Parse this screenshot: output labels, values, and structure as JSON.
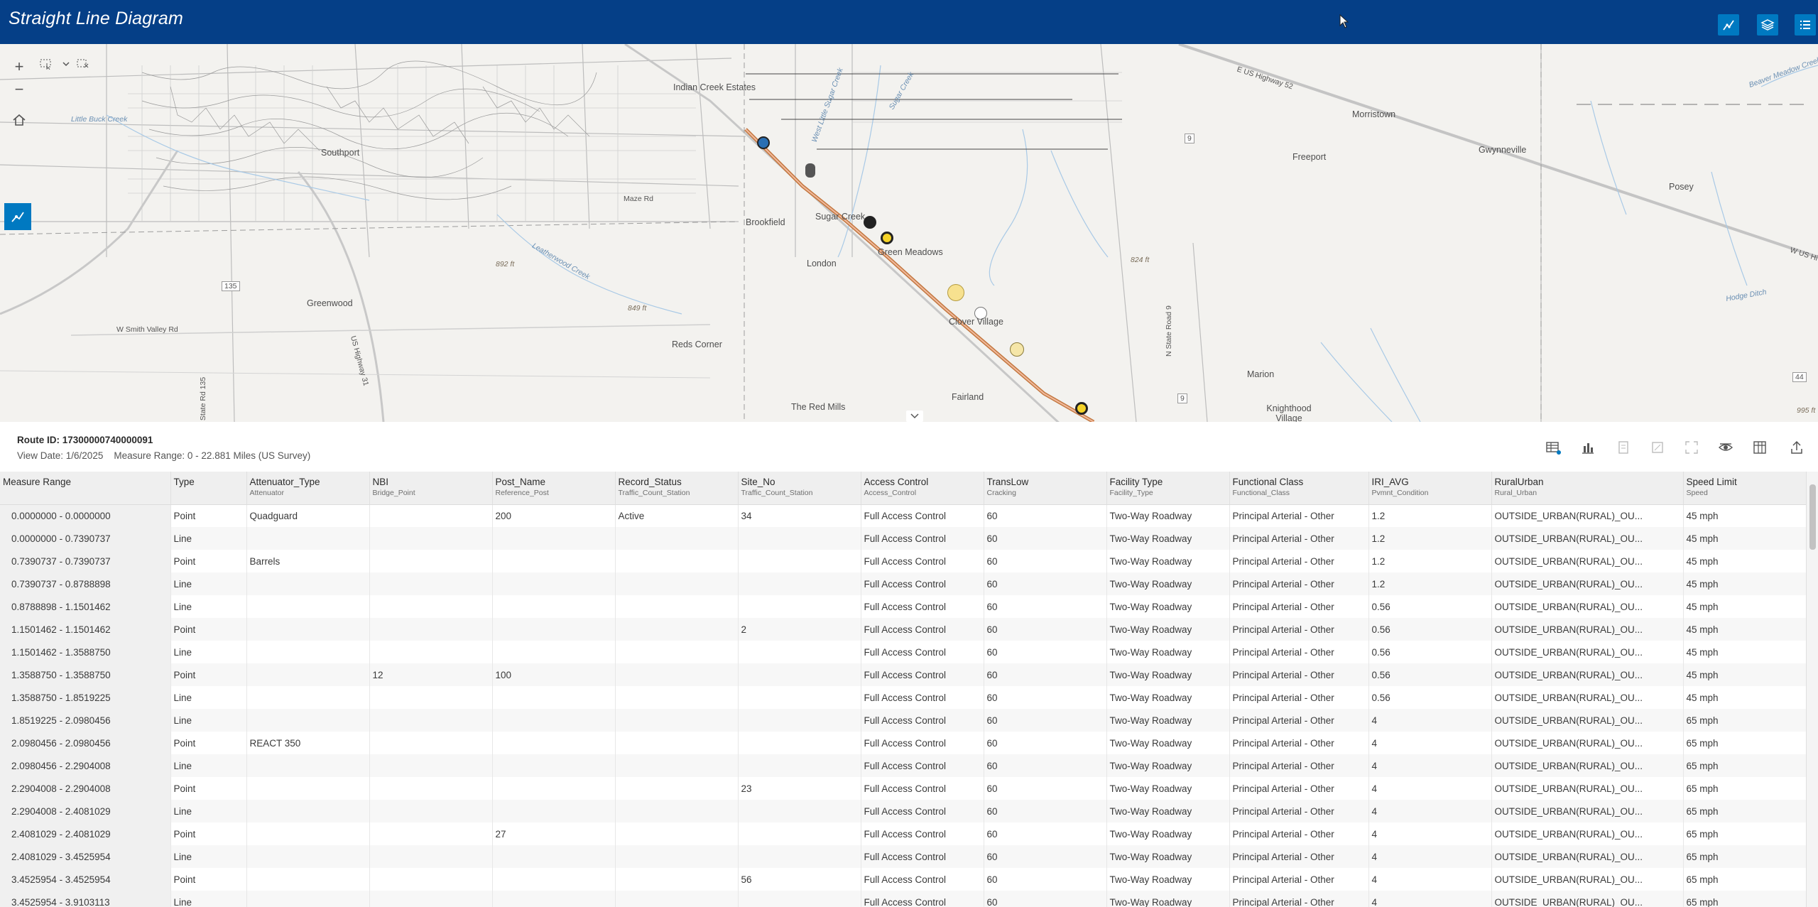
{
  "app": {
    "title": "Straight Line Diagram"
  },
  "colors": {
    "header": "#053f87",
    "accent": "#0079c1"
  },
  "header_buttons": [
    {
      "icon": "sld-chart-icon"
    },
    {
      "icon": "layers-icon"
    },
    {
      "icon": "list-icon"
    }
  ],
  "map": {
    "zoom_in": "+",
    "zoom_out": "−",
    "labels": {
      "indian_creek": "Indian Creek Estates",
      "southport": "Southport",
      "brookfield": "Brookfield",
      "sugar_creek": "Sugar Creek",
      "shelbyville_meadows": "Green Meadows",
      "london": "London",
      "greenwood": "Greenwood",
      "smith_valley": "W Smith Valley Rd",
      "reds_corner": "Reds Corner",
      "clover": "Clover Village",
      "fairland": "Fairland",
      "red_mills": "The Red Mills",
      "marion": "Marion",
      "knighthood": "Knighthood Village",
      "morristown": "Morristown",
      "gwynneville": "Gwynneville",
      "freeport": "Freeport",
      "posey": "Posey",
      "us52": "E US Highway 52",
      "us52b": "W US Hi",
      "maze": "Maze Rd",
      "elev1": "892 ft",
      "elev2": "849 ft",
      "elev3": "824 ft",
      "elev4": "995 ft",
      "r135": "135",
      "r9a": "9",
      "r9b": "9",
      "r44": "44",
      "state_road_9": "N State Road 9",
      "little_buck": "Little Buck Creek",
      "leatherwood": "Leatherwood Creek",
      "sugar_creek_w": "West Little Sugar Creek",
      "sugar_creek_e": "Sugar Creek",
      "hodge": "Hodge Ditch",
      "beaver": "Beaver Meadow Creek",
      "us31": "US Highway 31",
      "s_state_rd": "S State Rd 135"
    }
  },
  "info": {
    "route_id": "Route ID: 17300000740000091",
    "view_date": "View Date: 1/6/2025",
    "measure_range": "Measure Range: 0 - 22.881 Miles (US Survey)"
  },
  "table": {
    "columns": [
      {
        "title": "Measure Range",
        "sub": ""
      },
      {
        "title": "Type",
        "sub": ""
      },
      {
        "title": "Attenuator_Type",
        "sub": "Attenuator"
      },
      {
        "title": "NBI",
        "sub": "Bridge_Point"
      },
      {
        "title": "Post_Name",
        "sub": "Reference_Post"
      },
      {
        "title": "Record_Status",
        "sub": "Traffic_Count_Station"
      },
      {
        "title": "Site_No",
        "sub": "Traffic_Count_Station"
      },
      {
        "title": "Access Control",
        "sub": "Access_Control"
      },
      {
        "title": "TransLow",
        "sub": "Cracking"
      },
      {
        "title": "Facility Type",
        "sub": "Facility_Type"
      },
      {
        "title": "Functional Class",
        "sub": "Functional_Class"
      },
      {
        "title": "IRI_AVG",
        "sub": "Pvmnt_Condition"
      },
      {
        "title": "RuralUrban",
        "sub": "Rural_Urban"
      },
      {
        "title": "Speed Limit",
        "sub": "Speed"
      }
    ],
    "rows": [
      [
        "0.0000000  -  0.0000000",
        "Point",
        "Quadguard",
        "",
        "200",
        "Active",
        "34",
        "Full Access Control",
        "60",
        "Two-Way Roadway",
        "Principal Arterial - Other",
        "1.2",
        "OUTSIDE_URBAN(RURAL)_OU...",
        "45 mph"
      ],
      [
        "0.0000000  -  0.7390737",
        "Line",
        "",
        "",
        "",
        "",
        "",
        "Full Access Control",
        "60",
        "Two-Way Roadway",
        "Principal Arterial - Other",
        "1.2",
        "OUTSIDE_URBAN(RURAL)_OU...",
        "45 mph"
      ],
      [
        "0.7390737  -  0.7390737",
        "Point",
        "Barrels",
        "",
        "",
        "",
        "",
        "Full Access Control",
        "60",
        "Two-Way Roadway",
        "Principal Arterial - Other",
        "1.2",
        "OUTSIDE_URBAN(RURAL)_OU...",
        "45 mph"
      ],
      [
        "0.7390737  -  0.8788898",
        "Line",
        "",
        "",
        "",
        "",
        "",
        "Full Access Control",
        "60",
        "Two-Way Roadway",
        "Principal Arterial - Other",
        "1.2",
        "OUTSIDE_URBAN(RURAL)_OU...",
        "45 mph"
      ],
      [
        "0.8788898  -  1.1501462",
        "Line",
        "",
        "",
        "",
        "",
        "",
        "Full Access Control",
        "60",
        "Two-Way Roadway",
        "Principal Arterial - Other",
        "0.56",
        "OUTSIDE_URBAN(RURAL)_OU...",
        "45 mph"
      ],
      [
        "1.1501462  -  1.1501462",
        "Point",
        "",
        "",
        "",
        "",
        "2",
        "Full Access Control",
        "60",
        "Two-Way Roadway",
        "Principal Arterial - Other",
        "0.56",
        "OUTSIDE_URBAN(RURAL)_OU...",
        "45 mph"
      ],
      [
        "1.1501462  -  1.3588750",
        "Line",
        "",
        "",
        "",
        "",
        "",
        "Full Access Control",
        "60",
        "Two-Way Roadway",
        "Principal Arterial - Other",
        "0.56",
        "OUTSIDE_URBAN(RURAL)_OU...",
        "45 mph"
      ],
      [
        "1.3588750  -  1.3588750",
        "Point",
        "",
        "12",
        "100",
        "",
        "",
        "Full Access Control",
        "60",
        "Two-Way Roadway",
        "Principal Arterial - Other",
        "0.56",
        "OUTSIDE_URBAN(RURAL)_OU...",
        "45 mph"
      ],
      [
        "1.3588750  -  1.8519225",
        "Line",
        "",
        "",
        "",
        "",
        "",
        "Full Access Control",
        "60",
        "Two-Way Roadway",
        "Principal Arterial - Other",
        "0.56",
        "OUTSIDE_URBAN(RURAL)_OU...",
        "45 mph"
      ],
      [
        "1.8519225  -  2.0980456",
        "Line",
        "",
        "",
        "",
        "",
        "",
        "Full Access Control",
        "60",
        "Two-Way Roadway",
        "Principal Arterial - Other",
        "4",
        "OUTSIDE_URBAN(RURAL)_OU...",
        "65 mph"
      ],
      [
        "2.0980456  -  2.0980456",
        "Point",
        "REACT 350",
        "",
        "",
        "",
        "",
        "Full Access Control",
        "60",
        "Two-Way Roadway",
        "Principal Arterial - Other",
        "4",
        "OUTSIDE_URBAN(RURAL)_OU...",
        "65 mph"
      ],
      [
        "2.0980456  -  2.2904008",
        "Line",
        "",
        "",
        "",
        "",
        "",
        "Full Access Control",
        "60",
        "Two-Way Roadway",
        "Principal Arterial - Other",
        "4",
        "OUTSIDE_URBAN(RURAL)_OU...",
        "65 mph"
      ],
      [
        "2.2904008  -  2.2904008",
        "Point",
        "",
        "",
        "",
        "",
        "23",
        "Full Access Control",
        "60",
        "Two-Way Roadway",
        "Principal Arterial - Other",
        "4",
        "OUTSIDE_URBAN(RURAL)_OU...",
        "65 mph"
      ],
      [
        "2.2904008  -  2.4081029",
        "Line",
        "",
        "",
        "",
        "",
        "",
        "Full Access Control",
        "60",
        "Two-Way Roadway",
        "Principal Arterial - Other",
        "4",
        "OUTSIDE_URBAN(RURAL)_OU...",
        "65 mph"
      ],
      [
        "2.4081029  -  2.4081029",
        "Point",
        "",
        "",
        "27",
        "",
        "",
        "Full Access Control",
        "60",
        "Two-Way Roadway",
        "Principal Arterial - Other",
        "4",
        "OUTSIDE_URBAN(RURAL)_OU...",
        "65 mph"
      ],
      [
        "2.4081029  -  3.4525954",
        "Line",
        "",
        "",
        "",
        "",
        "",
        "Full Access Control",
        "60",
        "Two-Way Roadway",
        "Principal Arterial - Other",
        "4",
        "OUTSIDE_URBAN(RURAL)_OU...",
        "65 mph"
      ],
      [
        "3.4525954  -  3.4525954",
        "Point",
        "",
        "",
        "",
        "",
        "56",
        "Full Access Control",
        "60",
        "Two-Way Roadway",
        "Principal Arterial - Other",
        "4",
        "OUTSIDE_URBAN(RURAL)_OU...",
        "65 mph"
      ],
      [
        "3.4525954  -  3.9103113",
        "Line",
        "",
        "",
        "",
        "",
        "",
        "Full Access Control",
        "60",
        "Two-Way Roadway",
        "Principal Arterial - Other",
        "4",
        "OUTSIDE_URBAN(RURAL)_OU...",
        "65 mph"
      ]
    ]
  }
}
